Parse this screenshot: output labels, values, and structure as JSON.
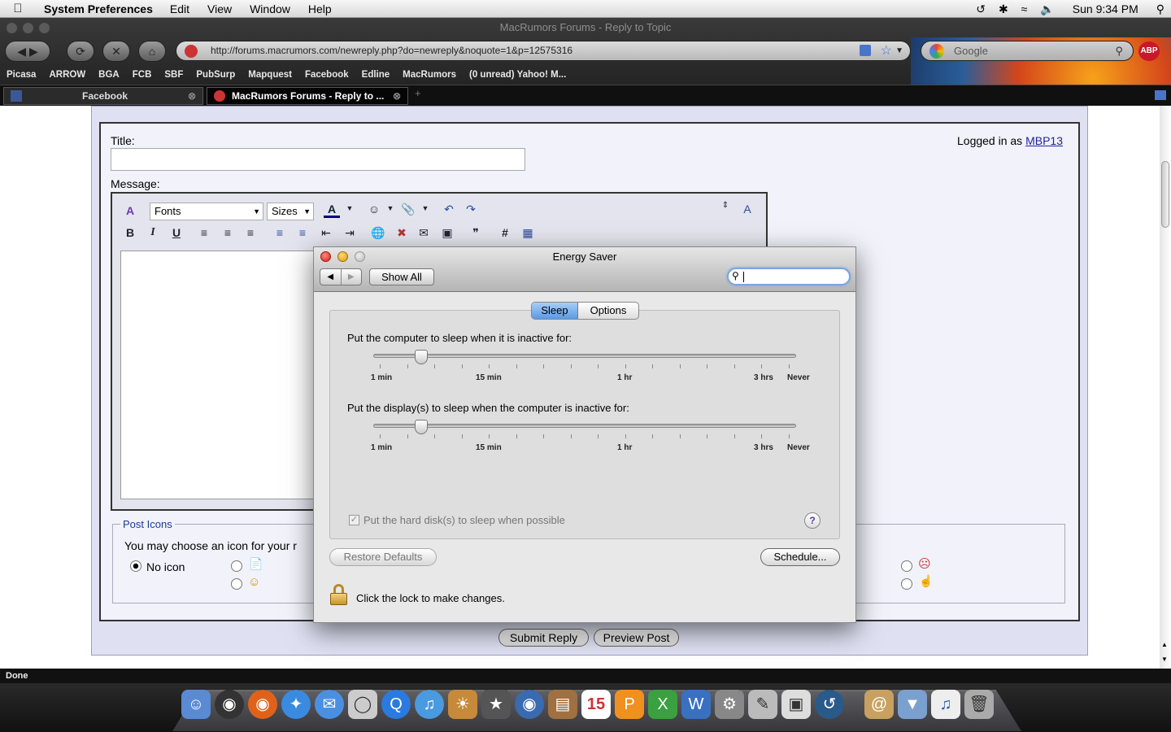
{
  "menubar": {
    "app_name": "System Preferences",
    "items": [
      "Edit",
      "View",
      "Window",
      "Help"
    ],
    "clock": "Sun 9:34 PM"
  },
  "browser": {
    "window_title": "MacRumors Forums - Reply to Topic",
    "url": "http://forums.macrumors.com/newreply.php?do=newreply&noquote=1&p=12575316",
    "search_placeholder": "Google",
    "bookmarks": [
      "Picasa",
      "ARROW",
      "BGA",
      "FCB",
      "SBF",
      "PubSurp",
      "Mapquest",
      "Facebook",
      "Edline",
      "MacRumors",
      "(0 unread) Yahoo! M..."
    ],
    "tabs": [
      {
        "label": "Facebook"
      },
      {
        "label": "MacRumors Forums - Reply to ..."
      }
    ],
    "status": "Done",
    "adblock_label": "ABP"
  },
  "page": {
    "title_label": "Title:",
    "message_label": "Message:",
    "logged_in_prefix": "Logged in as",
    "logged_in_user": "MBP13",
    "fonts_select": "Fonts",
    "sizes_select": "Sizes",
    "post_icons_legend": "Post Icons",
    "post_icons_text": "You may choose an icon for your r",
    "no_icon_label": "No icon",
    "submit_label": "Submit Reply",
    "preview_label": "Preview Post"
  },
  "dialog": {
    "title": "Energy Saver",
    "show_all": "Show All",
    "tabs": [
      "Sleep",
      "Options"
    ],
    "selected_tab": "Sleep",
    "computer_sleep_label": "Put the computer to sleep when it is inactive for:",
    "display_sleep_label": "Put the display(s) to sleep when the computer is inactive for:",
    "tick_labels": [
      "1 min",
      "15 min",
      "1 hr",
      "3 hrs",
      "Never"
    ],
    "computer_sleep_value": "15 min",
    "display_sleep_value": "15 min",
    "hard_disk_label": "Put the hard disk(s) to sleep when possible",
    "hard_disk_checked": true,
    "restore_defaults": "Restore Defaults",
    "schedule": "Schedule...",
    "lock_text": "Click the lock to make changes."
  }
}
